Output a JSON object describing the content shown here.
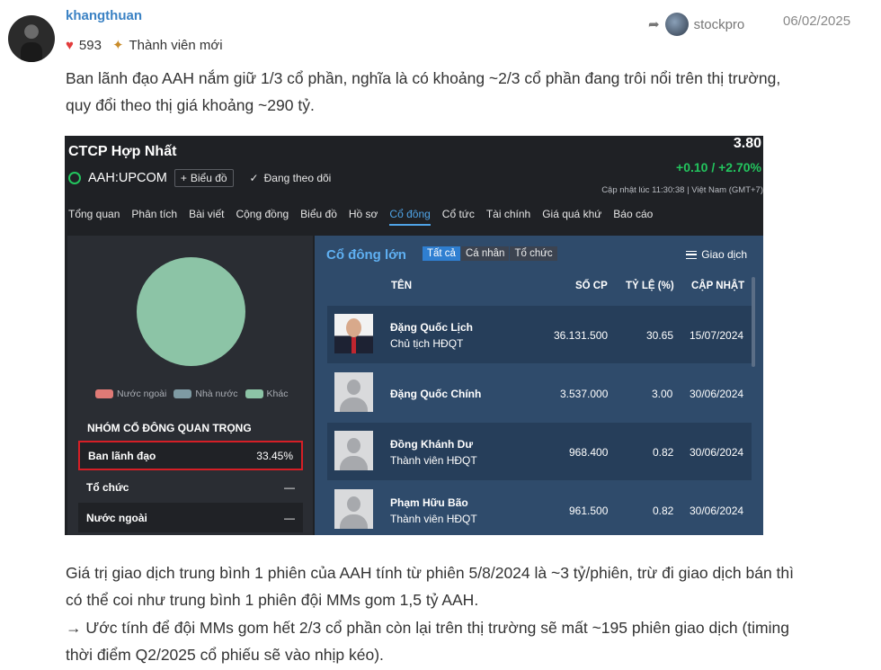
{
  "post": {
    "username": "khangthuan",
    "likes": "593",
    "rank": "Thành viên mới",
    "shared_by": "stockpro",
    "date": "06/02/2025",
    "paragraph1_line1": "Ban lãnh đạo AAH nắm giữ 1/3 cổ phần, nghĩa là có khoảng ~2/3 cổ phần đang trôi nổi trên thị trường,",
    "paragraph1_line2": "quy đổi theo thị giá khoảng ~290 tỷ.",
    "paragraph2_line1": "Giá trị giao dịch trung bình 1 phiên của AAH tính từ phiên 5/8/2024 là ~3 tỷ/phiên, trừ đi giao dịch bán thì",
    "paragraph2_line2": "có thể coi như trung bình 1 phiên đội MMs gom 1,5 tỷ AAH.",
    "paragraph2_line3": "→ Ước tính để đội MMs gom hết 2/3 cổ phần còn lại trên thị trường sẽ mất ~195 phiên giao dịch (timing",
    "paragraph2_line4": "thời điểm Q2/2025 cổ phiếu sẽ vào nhịp kéo)."
  },
  "stock": {
    "company": "CTCP Hợp Nhất",
    "ticker": "AAH:UPCOM",
    "chart_button": "Biểu đồ",
    "follow_label": "Đang theo dõi",
    "price": "3.80",
    "change": "+0.10 / +2.70%",
    "updated": "Cập nhật lúc  11:30:38 | Việt Nam (GMT+7)",
    "tabs": [
      "Tổng quan",
      "Phân tích",
      "Bài viết",
      "Cộng đồng",
      "Biểu đồ",
      "Hồ sơ",
      "Cổ đông",
      "Cổ tức",
      "Tài chính",
      "Giá quá khứ",
      "Báo cáo"
    ],
    "active_tab": "Cổ đông",
    "legend": [
      {
        "label": "Nước ngoài",
        "color": "#e07a76"
      },
      {
        "label": "Nhà nước",
        "color": "#7e9aa3"
      },
      {
        "label": "Khác",
        "color": "#8cc4a6"
      }
    ],
    "group_title": "NHÓM CỔ ĐÔNG QUAN TRỌNG",
    "groups": [
      {
        "label": "Ban lãnh đạo",
        "value": "33.45%"
      },
      {
        "label": "Tổ chức",
        "value": "—"
      },
      {
        "label": "Nước ngoài",
        "value": "—"
      }
    ],
    "major_title": "Cổ đông lớn",
    "filters": [
      "Tất cả",
      "Cá nhân",
      "Tổ chức"
    ],
    "trade_label": "Giao dịch",
    "columns": {
      "name": "TÊN",
      "shares": "SỐ CP",
      "ratio": "TỶ LỆ (%)",
      "updated": "CẬP NHẬT"
    },
    "shareholders": [
      {
        "name": "Đặng Quốc Lịch",
        "role": "Chủ tịch HĐQT",
        "shares": "36.131.500",
        "ratio": "30.65",
        "date": "15/07/2024"
      },
      {
        "name": "Đặng Quốc Chính",
        "role": "",
        "shares": "3.537.000",
        "ratio": "3.00",
        "date": "30/06/2024"
      },
      {
        "name": "Đồng Khánh Dư",
        "role": "Thành viên HĐQT",
        "shares": "968.400",
        "ratio": "0.82",
        "date": "30/06/2024"
      },
      {
        "name": "Phạm Hữu Bão",
        "role": "Thành viên HĐQT",
        "shares": "961.500",
        "ratio": "0.82",
        "date": "30/06/2024"
      }
    ]
  }
}
